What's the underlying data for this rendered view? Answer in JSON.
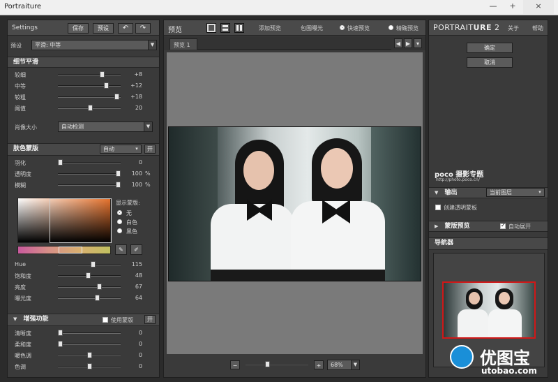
{
  "window": {
    "title": "Portraiture",
    "min": "—",
    "max": "+",
    "close": "×"
  },
  "left": {
    "settings_label": "Settings",
    "save": "保存",
    "preset_btn": "预设",
    "undo": "↶",
    "redo": "↷",
    "preset_label": "预设",
    "preset_value": "平滑: 中等",
    "detail": {
      "title": "细节平滑",
      "sliders": [
        {
          "label": "较细",
          "value": "+8",
          "pos": 0.72
        },
        {
          "label": "中等",
          "value": "+12",
          "pos": 0.8
        },
        {
          "label": "较粗",
          "value": "+18",
          "pos": 0.98
        },
        {
          "label": "阈值",
          "value": "20",
          "pos": 0.52
        }
      ],
      "size_label": "肖像大小",
      "size_value": "自动检测"
    },
    "mask": {
      "title": "肤色蒙版",
      "mode": "自动",
      "toggle": "开",
      "sliders": [
        {
          "label": "羽化",
          "value": "0",
          "unit": "",
          "pos": 0.0
        },
        {
          "label": "透明度",
          "value": "100",
          "unit": "%",
          "pos": 1.0
        },
        {
          "label": "模糊",
          "value": "100",
          "unit": "%",
          "pos": 1.0
        }
      ],
      "show_label": "显示蒙版:",
      "options": [
        "无",
        "白色",
        "黑色"
      ],
      "selected": 0,
      "hsl": [
        {
          "label": "Hue",
          "value": "115",
          "pos": 0.57
        },
        {
          "label": "饱和度",
          "value": "48",
          "pos": 0.48
        },
        {
          "label": "亮度",
          "value": "67",
          "pos": 0.67
        },
        {
          "label": "曝光度",
          "value": "64",
          "pos": 0.64
        }
      ]
    },
    "enhance": {
      "title": "增强功能",
      "use_mask": "使用蒙版",
      "toggle": "开",
      "sliders": [
        {
          "label": "清晰度",
          "value": "0",
          "pos": 0.0
        },
        {
          "label": "柔和度",
          "value": "0",
          "pos": 0.0
        },
        {
          "label": "暖色调",
          "value": "0",
          "pos": 0.5
        },
        {
          "label": "色调",
          "value": "0",
          "pos": 0.5
        }
      ]
    }
  },
  "center": {
    "preview_label": "预览",
    "add_preview": "添加预览",
    "exposure": "包围曝光",
    "quick": "快速预览",
    "precise": "精确预览",
    "tab": "预览 1",
    "zoom": "68%",
    "minus": "−",
    "plus": "+"
  },
  "right": {
    "logo_thin": "PORTRAIT",
    "logo_bold": "URE",
    "logo_ver": "2",
    "about": "关于",
    "help": "帮助",
    "ok": "确定",
    "cancel": "取消",
    "watermark_title": "poco 摄影专题",
    "watermark_url": "http://photo.poco.cn/",
    "output_label": "输出",
    "output_value": "当前图层",
    "transparent": "创建透明蒙板",
    "mask_preview": "蒙版预览",
    "auto_expand": "自动展开",
    "navigator": "导航器",
    "bottom_logo": "优图宝",
    "bottom_url": "utobao.com"
  },
  "colors": {
    "accent": "#e07a30",
    "nav_frame": "#d01818",
    "logo_blue": "#1a8fd8"
  }
}
